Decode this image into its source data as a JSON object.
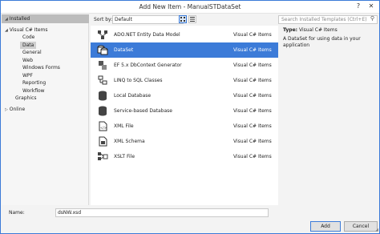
{
  "window": {
    "title": "Add New Item - ManualSTDataSet",
    "help": "?",
    "close": "✕"
  },
  "left_panel": {
    "installed": "Installed",
    "tree": [
      {
        "label": "Visual C# Items",
        "expanded": true
      },
      {
        "label": "Code"
      },
      {
        "label": "Data",
        "selected": true
      },
      {
        "label": "General"
      },
      {
        "label": "Web"
      },
      {
        "label": "Windows Forms"
      },
      {
        "label": "WPF"
      },
      {
        "label": "Reporting"
      },
      {
        "label": "Workflow"
      },
      {
        "label": "Graphics"
      },
      {
        "label": "Online"
      }
    ]
  },
  "toolbar": {
    "sort_label": "Sort by:",
    "sort_value": "Default",
    "search_placeholder": "Search Installed Templates (Ctrl+E)"
  },
  "items": [
    {
      "name": "ADO.NET Entity Data Model",
      "lang": "Visual C# Items",
      "icon": "entity-model-icon"
    },
    {
      "name": "DataSet",
      "lang": "Visual C# Items",
      "icon": "dataset-icon",
      "selected": true
    },
    {
      "name": "EF 5.x DbContext Generator",
      "lang": "Visual C# Items",
      "icon": "dbcontext-generator-icon"
    },
    {
      "name": "LINQ to SQL Classes",
      "lang": "Visual C# Items",
      "icon": "linq-to-sql-icon"
    },
    {
      "name": "Local Database",
      "lang": "Visual C# Items",
      "icon": "database-icon"
    },
    {
      "name": "Service-based Database",
      "lang": "Visual C# Items",
      "icon": "database-icon"
    },
    {
      "name": "XML File",
      "lang": "Visual C# Items",
      "icon": "xml-file-icon"
    },
    {
      "name": "XML Schema",
      "lang": "Visual C# Items",
      "icon": "xml-schema-icon"
    },
    {
      "name": "XSLT File",
      "lang": "Visual C# Items",
      "icon": "xslt-file-icon"
    }
  ],
  "details": {
    "type_label": "Type:",
    "type_value": "Visual C# Items",
    "description": "A DataSet for using data in your application"
  },
  "footer": {
    "name_label": "Name:",
    "name_value": "dsNW.xsd",
    "add_label": "Add",
    "cancel_label": "Cancel"
  },
  "colors": {
    "accent": "#3c7bd8",
    "installed_header": "#bcbcbc",
    "tree_selected": "#cfcfcf"
  }
}
